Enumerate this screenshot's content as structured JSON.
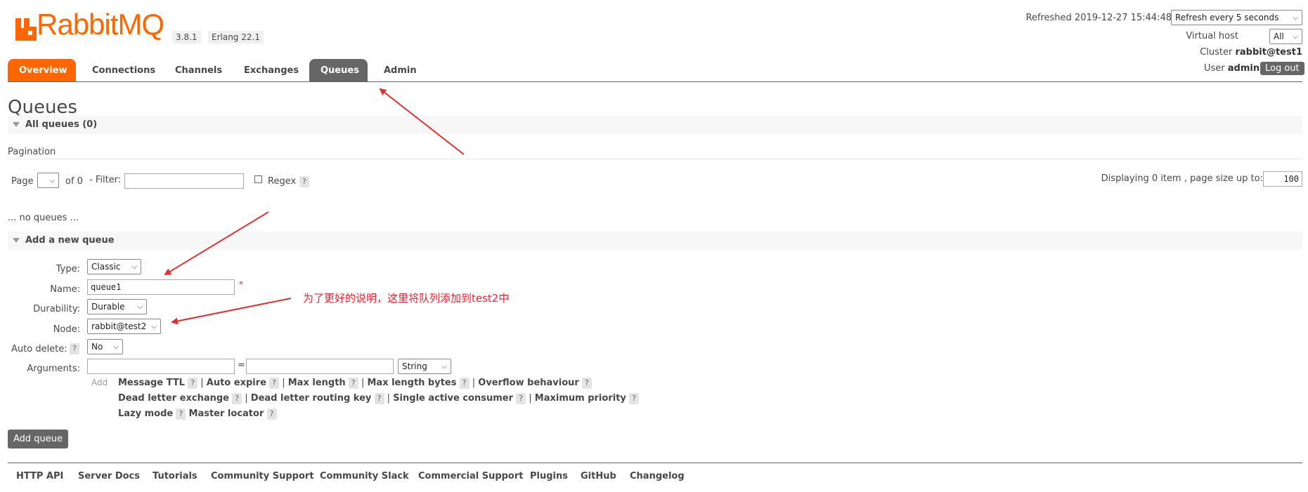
{
  "header": {
    "brand": "RabbitMQ",
    "version": "3.8.1",
    "erlang": "Erlang 22.1",
    "refreshed_label": "Refreshed 2019-12-27 15:44:48",
    "refresh_select": "Refresh every 5 seconds",
    "vhost_label": "Virtual host",
    "vhost_value": "All",
    "cluster_label": "Cluster",
    "cluster_value": "rabbit@test1",
    "user_label": "User",
    "user_value": "admin",
    "logout_label": "Log out"
  },
  "tabs": [
    "Overview",
    "Connections",
    "Channels",
    "Exchanges",
    "Queues",
    "Admin"
  ],
  "page": {
    "title": "Queues",
    "all_queues": "All queues (0)",
    "pagination": "Pagination",
    "page_label": "Page",
    "of_label": "of 0",
    "filter_label": "- Filter:",
    "regex_label": "Regex",
    "q": "?",
    "displaying_label": "Displaying 0 item , page size up to:",
    "page_size": "100",
    "no_queues": "... no queues ..."
  },
  "add_queue": {
    "section_title": "Add a new queue",
    "type_label": "Type:",
    "type_value": "Classic",
    "name_label": "Name:",
    "name_value": "queue1",
    "required_mark": "*",
    "durability_label": "Durability:",
    "durability_value": "Durable",
    "node_label": "Node:",
    "node_value": "rabbit@test2",
    "auto_delete_label": "Auto delete:",
    "auto_delete_value": "No",
    "arguments_label": "Arguments:",
    "equals": "=",
    "arg_type_value": "String",
    "add_label": "Add",
    "arg_links_row1": [
      "Message TTL",
      "Auto expire",
      "Max length",
      "Max length bytes",
      "Overflow behaviour"
    ],
    "arg_links_row2": [
      "Dead letter exchange",
      "Dead letter routing key",
      "Single active consumer",
      "Maximum priority"
    ],
    "arg_links_row3": [
      "Lazy mode",
      "Master locator"
    ],
    "submit_label": "Add queue"
  },
  "annotation": "为了更好的说明，这里将队列添加到test2中",
  "footer": [
    "HTTP API",
    "Server Docs",
    "Tutorials",
    "Community Support",
    "Community Slack",
    "Commercial Support",
    "Plugins",
    "GitHub",
    "Changelog"
  ],
  "colors": {
    "brand_orange": "#ff6600",
    "tab_grey": "#666666",
    "annotation_red": "#e62e2e"
  }
}
